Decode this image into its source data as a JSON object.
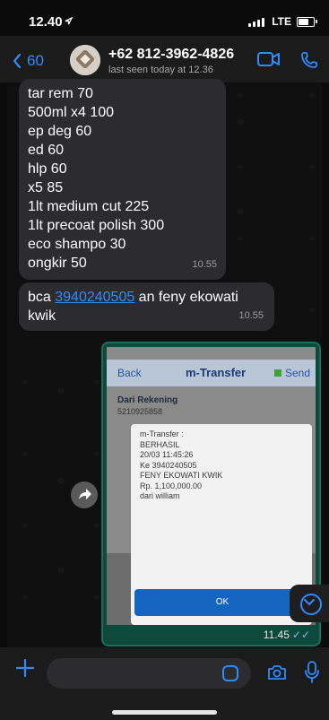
{
  "status": {
    "time": "12.40",
    "network": "LTE"
  },
  "header": {
    "back_count": "60",
    "contact": "+62 812-3962-4826",
    "last_seen": "last seen today at 12.36"
  },
  "messages": {
    "list_lines": [
      "tar rem 70",
      "500ml x4 100",
      "ep deg 60",
      "ed 60",
      "hlp 60",
      "x5 85",
      "1lt medium cut 225",
      "1lt precoat polish 300",
      "eco shampo 30",
      "ongkir 50"
    ],
    "list_time": "10.55",
    "bank_prefix": "bca ",
    "bank_number": "3940240505",
    "bank_suffix": " an feny ekowati kwik",
    "bank_time": "10.55",
    "image_time": "11.45"
  },
  "transfer_screenshot": {
    "back": "Back",
    "title": "m-Transfer",
    "send": "Send",
    "dari_rekening": "Dari Rekening",
    "account": "5210925858",
    "dialog_lines": [
      "m-Transfer :",
      "BERHASIL",
      "20/03 11:45:26",
      "Ke 3940240505",
      "FENY EKOWATI KWIK",
      "Rp. 1,100,000.00",
      "dari william"
    ],
    "ok": "OK"
  },
  "colors": {
    "accent": "#2f8bff",
    "bubble": "#2c2c2e",
    "ok_button": "#1565c0"
  }
}
